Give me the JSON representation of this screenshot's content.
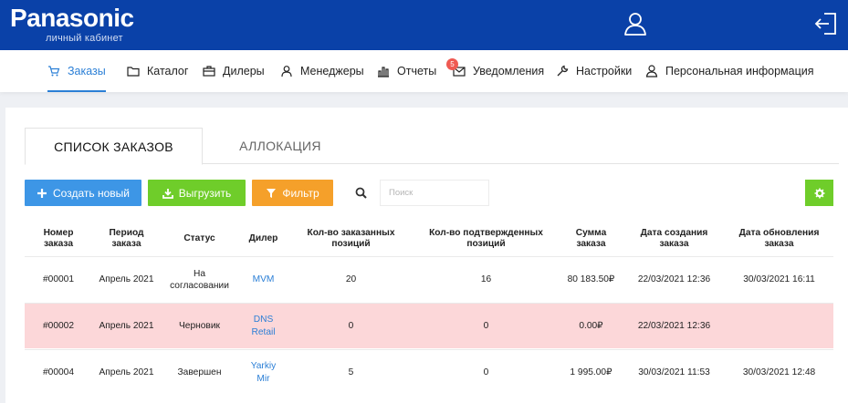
{
  "header": {
    "brand": "Panasonic",
    "subtitle": "личный кабинет",
    "user_icon": "user-icon",
    "logout_icon": "logout-icon"
  },
  "nav": {
    "items": [
      {
        "label": "Заказы",
        "icon": "cart-icon",
        "active": true
      },
      {
        "label": "Каталог",
        "icon": "folder-icon"
      },
      {
        "label": "Дилеры",
        "icon": "briefcase-icon"
      },
      {
        "label": "Менеджеры",
        "icon": "managers-icon"
      },
      {
        "label": "Отчеты",
        "icon": "bar-chart-icon"
      },
      {
        "label": "Уведомления",
        "icon": "envelope-icon",
        "badge": "5"
      },
      {
        "label": "Настройки",
        "icon": "wrench-icon"
      },
      {
        "label": "Персональная информация",
        "icon": "person-icon"
      }
    ]
  },
  "tabs": [
    {
      "label": "СПИСОК ЗАКАЗОВ",
      "active": true
    },
    {
      "label": "АЛЛОКАЦИЯ",
      "active": false
    }
  ],
  "toolbar": {
    "create_label": "Создать новый",
    "export_label": "Выгрузить",
    "filter_label": "Фильтр",
    "search_placeholder": "Поиск",
    "search_value": ""
  },
  "colors": {
    "header": "#0a41a8",
    "accent": "#2b7fd6",
    "create": "#3d96e6",
    "export": "#6fcd2a",
    "filter": "#f5a02a",
    "draft_row": "#fcd7d9"
  },
  "table": {
    "headers": [
      "Номер\nзаказа",
      "Период\nзаказа",
      "Статус",
      "Дилер",
      "Кол-во заказанных\nпозиций",
      "Кол-во подтвержденных\nпозиций",
      "Сумма\nзаказа",
      "Дата создания\nзаказа",
      "Дата обновления\nзаказа"
    ],
    "rows": [
      {
        "number": "#00001",
        "period": "Апрель 2021",
        "status": "На\nсогласовании",
        "dealer": "MVM",
        "ordered": "20",
        "confirmed": "16",
        "sum": "80 183.50₽",
        "created": "22/03/2021 12:36",
        "updated": "30/03/2021 16:11"
      },
      {
        "number": "#00002",
        "period": "Апрель 2021",
        "status": "Черновик",
        "dealer": "DNS\nRetail",
        "ordered": "0",
        "confirmed": "0",
        "sum": "0.00₽",
        "created": "22/03/2021 12:36",
        "updated": ""
      },
      {
        "number": "#00004",
        "period": "Апрель 2021",
        "status": "Завершен",
        "dealer": "Yarkiy\nMir",
        "ordered": "5",
        "confirmed": "0",
        "sum": "1 995.00₽",
        "created": "30/03/2021 11:53",
        "updated": "30/03/2021 12:48"
      }
    ]
  }
}
